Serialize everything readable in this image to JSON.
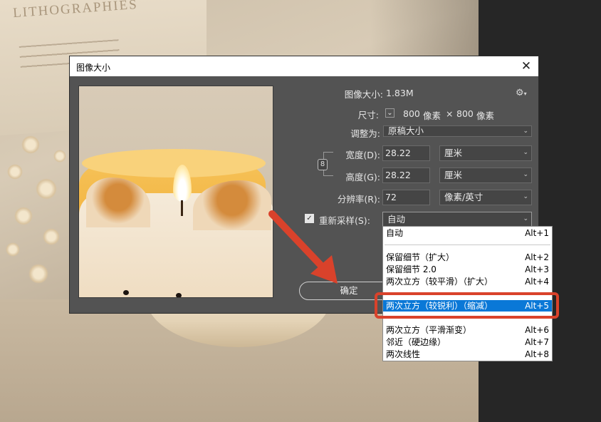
{
  "background": {
    "book_title": "LITHOGRAPHIES"
  },
  "dialog": {
    "title": "图像大小",
    "close_glyph": "✕",
    "image_size": {
      "label": "图像大小:",
      "value": "1.83M"
    },
    "dimensions": {
      "label": "尺寸:",
      "width_value": "800",
      "width_unit": "像素",
      "sep": "×",
      "height_value": "800",
      "height_unit": "像素"
    },
    "fit_to": {
      "label": "调整为:",
      "value": "原稿大小"
    },
    "width": {
      "label": "宽度(D):",
      "value": "28.22",
      "unit": "厘米"
    },
    "height": {
      "label": "高度(G):",
      "value": "28.22",
      "unit": "厘米"
    },
    "resolution": {
      "label": "分辨率(R):",
      "value": "72",
      "unit": "像素/英寸"
    },
    "resample": {
      "label": "重新采样(S):",
      "checked": true,
      "value": "自动"
    },
    "ok_label": "确定",
    "check_glyph": "✓",
    "chevron_glyph": "⌄",
    "link_glyph": "8",
    "gear_glyph": "⚙"
  },
  "dropdown": {
    "items": [
      {
        "label": "自动",
        "shortcut": "Alt+1"
      },
      {
        "label": "保留细节（扩大）",
        "shortcut": "Alt+2"
      },
      {
        "label": "保留细节 2.0",
        "shortcut": "Alt+3"
      },
      {
        "label": "两次立方（较平滑）（扩大）",
        "shortcut": "Alt+4"
      },
      {
        "label": "两次立方（较锐利）（缩减）",
        "shortcut": "Alt+5",
        "selected": true
      },
      {
        "label": "两次立方（平滑渐变）",
        "shortcut": "Alt+6"
      },
      {
        "label": "邻近（硬边缘）",
        "shortcut": "Alt+7"
      },
      {
        "label": "两次线性",
        "shortcut": "Alt+8"
      }
    ]
  },
  "colors": {
    "dialog_bg": "#535353",
    "selection": "#0a78d7",
    "annotation": "#d9422b"
  }
}
